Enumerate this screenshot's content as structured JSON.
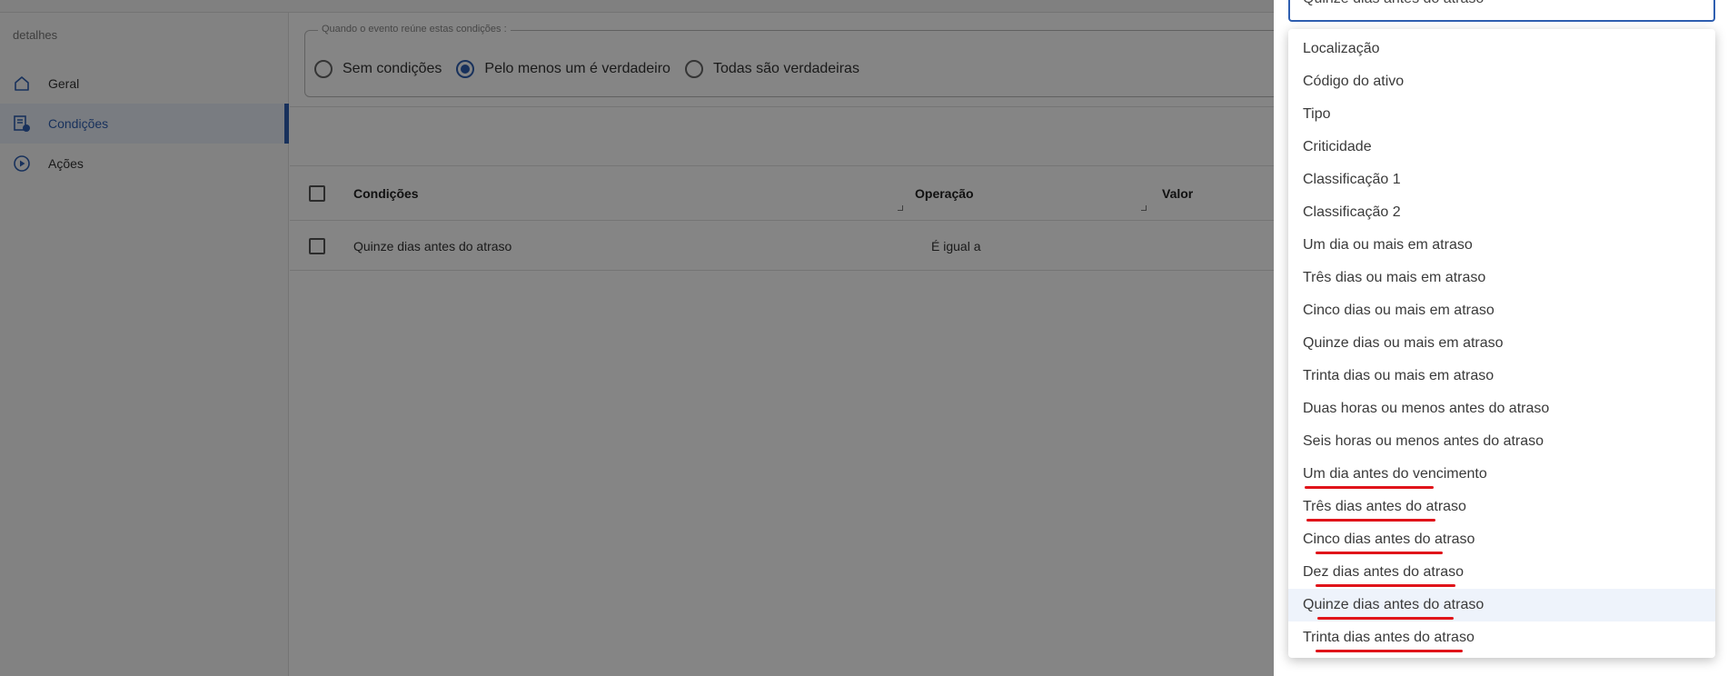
{
  "sidebar": {
    "title": "detalhes",
    "items": [
      {
        "label": "Geral",
        "icon": "home-icon"
      },
      {
        "label": "Condições",
        "icon": "list-settings-icon"
      },
      {
        "label": "Ações",
        "icon": "play-circle-icon"
      }
    ]
  },
  "conditions": {
    "legend": "Quando o evento reúne estas condições :",
    "options": [
      "Sem condições",
      "Pelo menos um é verdadeiro",
      "Todas são verdadeiras"
    ],
    "selected": "Pelo menos um é verdadeiro"
  },
  "table": {
    "headers": {
      "condition": "Condições",
      "operation": "Operação",
      "value": "Valor"
    },
    "rows": [
      {
        "condition": "Quinze dias antes do atraso",
        "operation": "É igual a"
      }
    ]
  },
  "select": {
    "value": "Quinze dias antes do atraso"
  },
  "dropdown": {
    "options": [
      "Localização",
      "Código do ativo",
      "Tipo",
      "Criticidade",
      "Classificação 1",
      "Classificação 2",
      "Um dia ou mais em atraso",
      "Três dias ou mais em atraso",
      "Cinco dias ou mais em atraso",
      "Quinze dias ou mais em atraso",
      "Trinta dias ou mais em atraso",
      "Duas horas ou menos antes do atraso",
      "Seis horas ou menos antes do atraso",
      "Um dia antes do vencimento",
      "Três dias antes do atraso",
      "Cinco dias antes do atraso",
      "Dez dias antes do atraso",
      "Quinze dias antes do atraso",
      "Trinta dias antes do atraso"
    ],
    "highlighted": "Quinze dias antes do atraso",
    "underlined": [
      "Um dia antes do vencimento",
      "Três dias antes do atraso",
      "Cinco dias antes do atraso",
      "Dez dias antes do atraso",
      "Quinze dias antes do atraso",
      "Trinta dias antes do atraso"
    ]
  },
  "colors": {
    "accent": "#2f5fb0",
    "annotation": "#e0141a",
    "overlay": "rgba(0,0,0,0.48)"
  }
}
